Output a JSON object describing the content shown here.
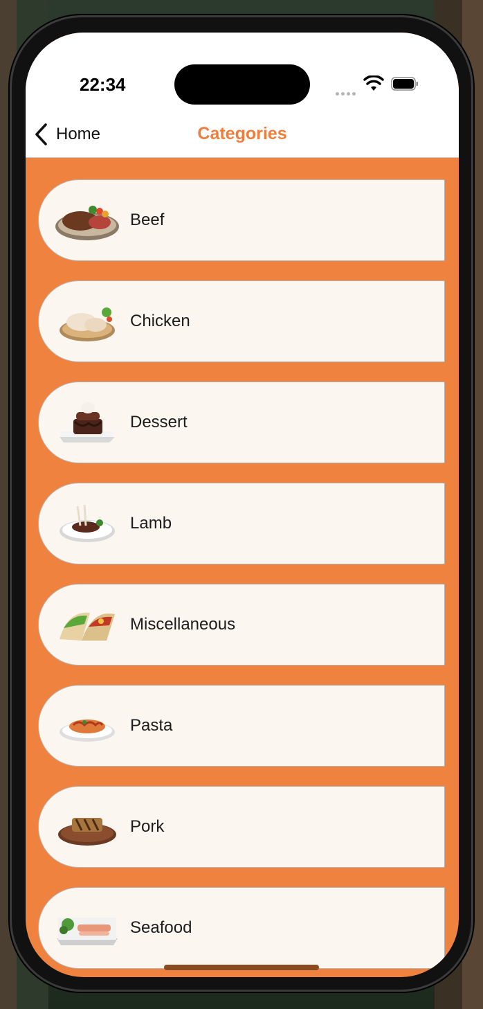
{
  "status_bar": {
    "time": "22:34"
  },
  "nav": {
    "back_label": "Home",
    "title": "Categories"
  },
  "categories": [
    {
      "label": "Beef",
      "icon": "beef-icon"
    },
    {
      "label": "Chicken",
      "icon": "chicken-icon"
    },
    {
      "label": "Dessert",
      "icon": "dessert-icon"
    },
    {
      "label": "Lamb",
      "icon": "lamb-icon"
    },
    {
      "label": "Miscellaneous",
      "icon": "tacos-icon"
    },
    {
      "label": "Pasta",
      "icon": "pasta-icon"
    },
    {
      "label": "Pork",
      "icon": "pork-icon"
    },
    {
      "label": "Seafood",
      "icon": "seafood-icon"
    }
  ],
  "colors": {
    "accent": "#F0823F",
    "title": "#EE7E3E",
    "card": "#FBF7F0"
  }
}
